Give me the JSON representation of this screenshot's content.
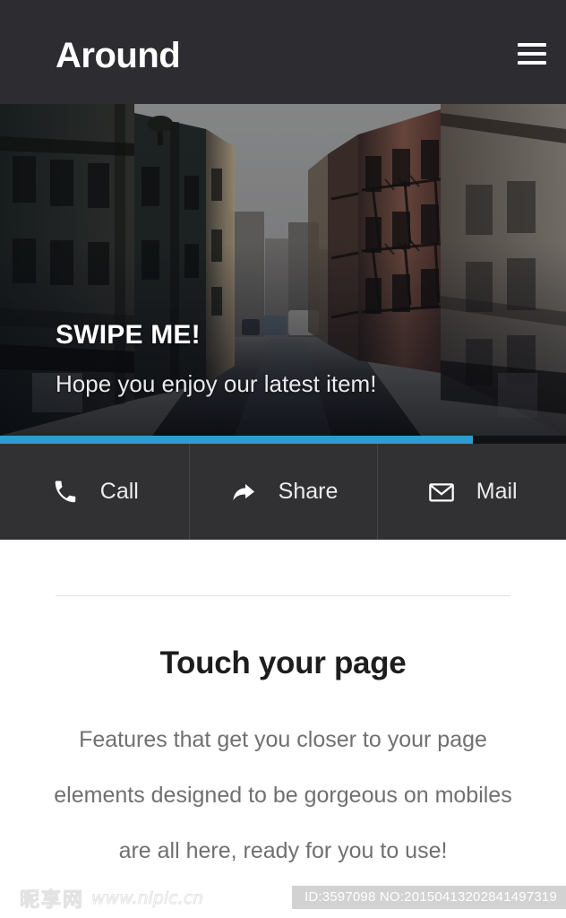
{
  "header": {
    "brand": "Around",
    "menu_icon": "hamburger-menu-icon"
  },
  "hero": {
    "title": "SWIPE ME!",
    "subtitle": "Hope you enjoy our latest item!",
    "image_description": "city street with buildings and fire escapes",
    "progress_percent": 83.5,
    "progress_color": "#2e9bd6",
    "track_color": "#121214"
  },
  "actions": {
    "items": [
      {
        "label": "Call",
        "icon": "phone-icon"
      },
      {
        "label": "Share",
        "icon": "share-arrow-icon"
      },
      {
        "label": "Mail",
        "icon": "envelope-icon"
      }
    ]
  },
  "content": {
    "title": "Touch your page",
    "body": "Features that get you closer to your page elements designed to be gorgeous on mobiles are all here, ready for you to use!"
  },
  "watermark": {
    "site_cn": "昵享网",
    "site_url": "www.nipic.cn",
    "id_text": "ID:3597098 NO:20150413202841497319"
  },
  "colors": {
    "header_bg": "#2c2c31",
    "action_bar_bg": "#313134",
    "accent_blue": "#2e9bd6",
    "title_text": "#1d1d1d",
    "body_text": "#6f7072"
  }
}
